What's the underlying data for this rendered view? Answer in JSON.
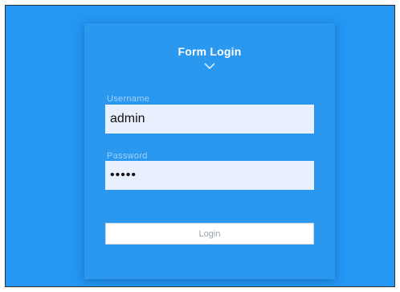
{
  "form": {
    "title": "Form Login",
    "username_label": "Username",
    "username_value": "admin",
    "password_label": "Password",
    "password_value": "•••••",
    "login_label": "Login"
  },
  "colors": {
    "background": "#2496f3",
    "card": "#2b98f0",
    "input_fill": "#e8f0fe",
    "button_fill": "#ffffff",
    "button_text": "#9aa3ad"
  },
  "icons": {
    "title_chevron": "chevron-down-icon"
  }
}
